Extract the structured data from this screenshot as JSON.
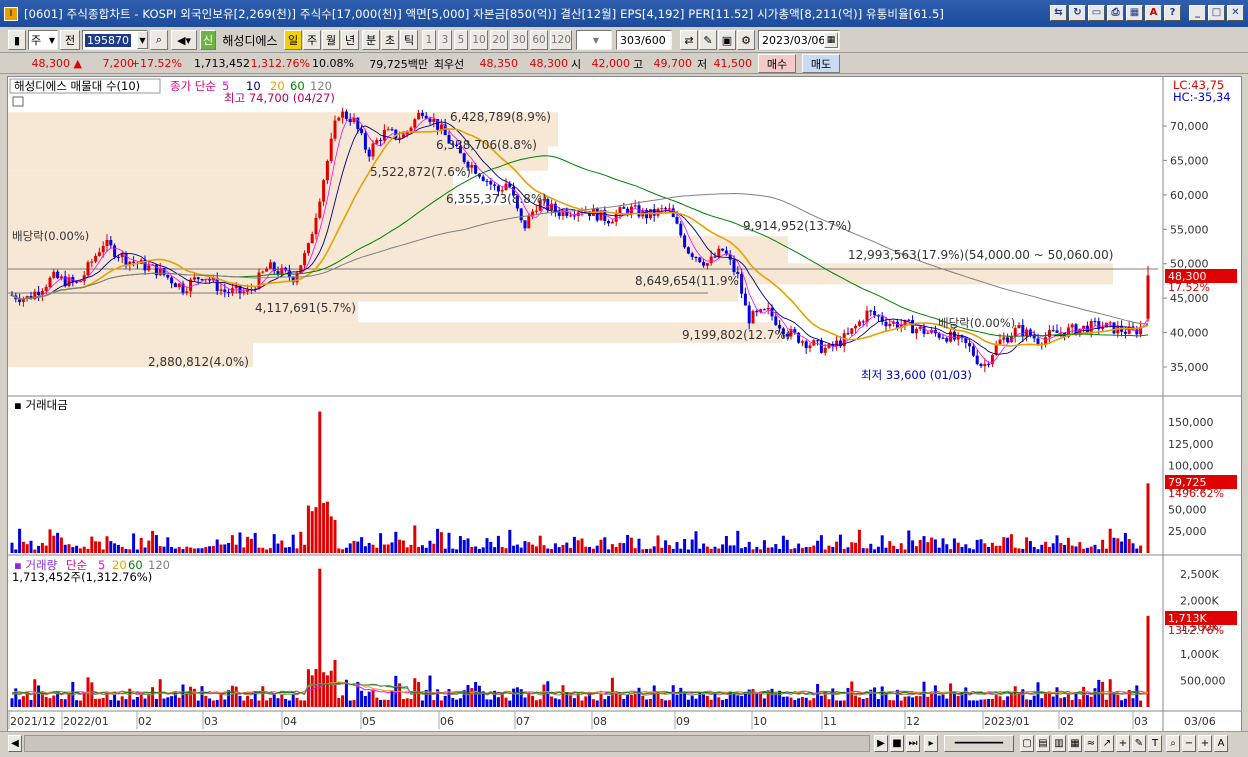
{
  "window": {
    "title": "[0601] 주식종합차트 - KOSPI 외국인보유[2,269(천)] 주식수[17,000(천)] 액면[5,000] 자본금[850(억)] 결산[12월] EPS[4,192] PER[11.52] 시가총액[8,211(억)] 유통비율[61.5]"
  },
  "toolbar": {
    "market_select": "주",
    "prev_label": "전",
    "stock_code": "195870",
    "stock_name": "해성디에스",
    "period_day": "일",
    "period_week": "주",
    "period_month": "월",
    "period_year": "년",
    "period_minute": "분",
    "period_second": "초",
    "period_tick": "틱",
    "intervals": [
      "1",
      "3",
      "5",
      "10",
      "20",
      "30",
      "60",
      "120"
    ],
    "count_current": "303",
    "count_total": "/600",
    "date": "2023/03/06"
  },
  "quote": {
    "price": "48,300",
    "change": "7,200",
    "change_rate": "+17.52%",
    "volume": "1,713,452",
    "volume_rate": "1,312.76%",
    "turnover_pct": "10.08%",
    "amount": "79,725백만",
    "best_ask_label": "최우선",
    "best_ask": "48,350",
    "best_bid": "48,300",
    "open_label": "시",
    "open": "42,000",
    "high_label": "고",
    "high": "49,700",
    "low_label": "저",
    "low": "41,500",
    "buy_label": "매수",
    "sell_label": "매도"
  },
  "price_panel": {
    "legend_name": "해성디에스 매물대 수(10)",
    "legend_ma_label": "종가 단순",
    "ma_periods": [
      "5",
      "10",
      "20",
      "60",
      "120"
    ],
    "ma_colors": [
      "#ff00ff",
      "#000080",
      "#e8a000",
      "#008000",
      "#808080"
    ],
    "lc": "LC:43,75",
    "hc": "HC:-35,34",
    "axis_ticks": [
      "70,000",
      "65,000",
      "60,000",
      "55,000",
      "50,000",
      "45,000",
      "40,000",
      "35,000"
    ],
    "current_price_tag": "48,300",
    "current_rate_tag": "17.52%",
    "high_annot": "최고 74,700 (04/27)",
    "low_annot": "최저 33,600 (01/03)",
    "dividend_1": "배당락(0.00%)",
    "dividend_2": "배당락(0.00%)",
    "profile_labels": [
      "6,428,789(8.9%)",
      "6,338,706(8.8%)",
      "5,522,872(7.6%)",
      "6,355,373(8.8%)",
      "9,914,952(13.7%)",
      "12,993,563(17.9%)(54,000.00 ~ 50,060.00)",
      "8,649,654(11.9%)",
      "4,117,691(5.7%)",
      "9,199,802(12.7%)",
      "2,880,812(4.0%)"
    ]
  },
  "amount_panel": {
    "title": "거래대금",
    "axis_ticks": [
      "150,000",
      "125,000",
      "100,000",
      "75,000",
      "50,000",
      "25,000"
    ],
    "value_tag": "79,725",
    "rate_tag": "1496.62%"
  },
  "volume_panel": {
    "legend_name": "거래량",
    "legend_ma_label": "단순",
    "ma_periods": [
      "5",
      "20",
      "60",
      "120"
    ],
    "summary": "1,713,452주(1,312.76%)",
    "axis_ticks": [
      "2,500K",
      "2,000K",
      "1,500K",
      "1,000K",
      "500,000"
    ],
    "value_tag": "1,713K",
    "rate_tag": "1312.76%"
  },
  "x_axis": {
    "labels": [
      "2021/12",
      "2022/01",
      "02",
      "03",
      "04",
      "05",
      "06",
      "07",
      "08",
      "09",
      "10",
      "11",
      "12",
      "2023/01",
      "02",
      "03"
    ],
    "last_label": "03/06"
  },
  "colors": {
    "up": "#e00000",
    "down": "#0000e0",
    "profile": "#f7e8d6",
    "tag_bg": "#e00000"
  }
}
